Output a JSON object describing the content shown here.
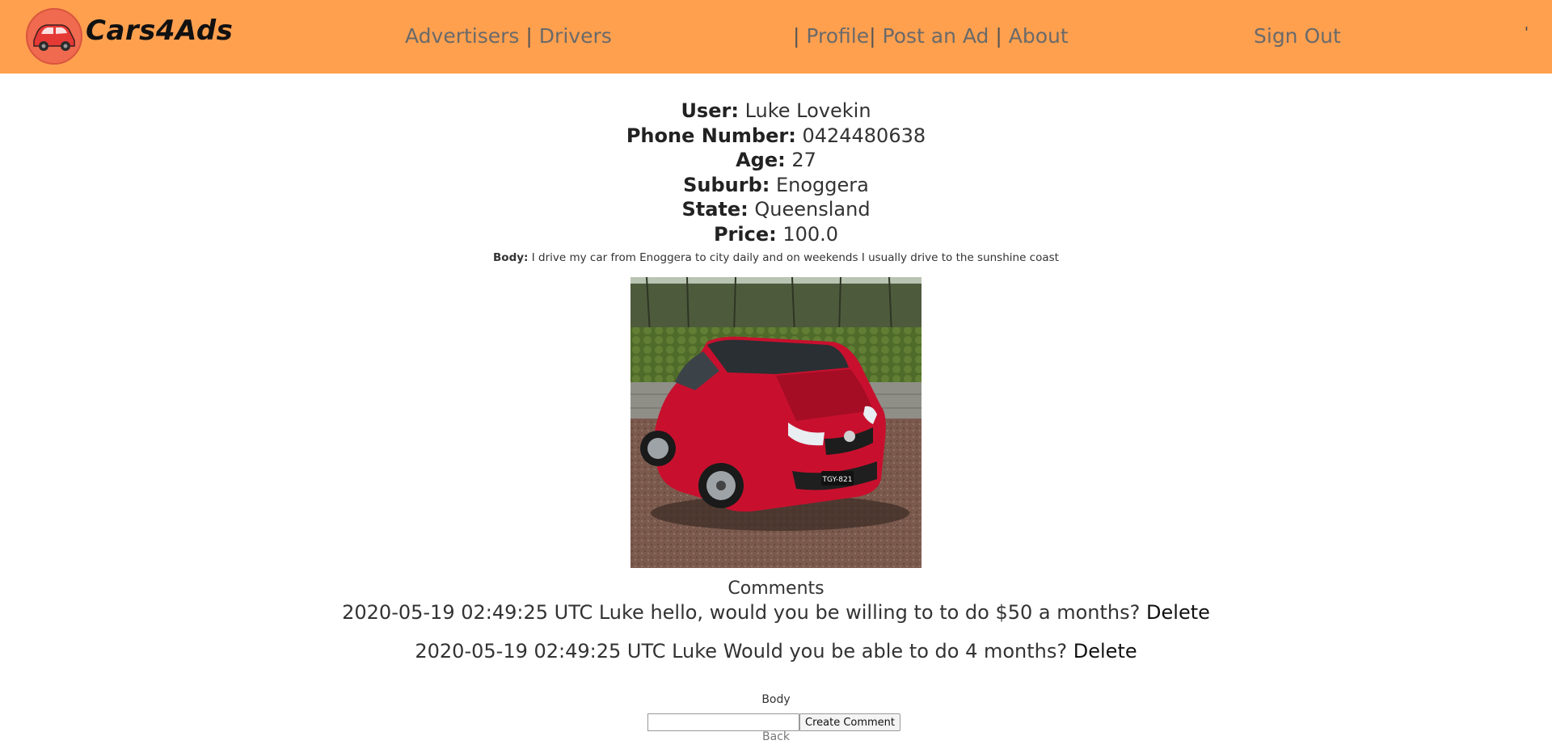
{
  "brand": {
    "name": "Cars4Ads",
    "logo_icon": "red-car-icon"
  },
  "nav": {
    "advertisers": "Advertisers",
    "drivers": "Drivers",
    "profile": "Profile",
    "post_ad": "Post an Ad",
    "about": "About",
    "sign_out": "Sign Out",
    "separator": "|",
    "tick": "'"
  },
  "details": {
    "user_label": "User:",
    "user_value": "Luke Lovekin",
    "phone_label": "Phone Number:",
    "phone_value": "0424480638",
    "age_label": "Age:",
    "age_value": "27",
    "suburb_label": "Suburb:",
    "suburb_value": "Enoggera",
    "state_label": "State:",
    "state_value": "Queensland",
    "price_label": "Price:",
    "price_value": "100.0",
    "body_label": "Body:",
    "body_value": "I drive my car from Enoggera to city daily and on weekends I usually drive to the sunshine coast"
  },
  "photo": {
    "plate": "TGY-821"
  },
  "comments": {
    "title": "Comments",
    "items": [
      {
        "text": "2020-05-19 02:49:25 UTC Luke hello, would you be willing to to do $50 a months?",
        "delete": "Delete"
      },
      {
        "text": "2020-05-19 02:49:25 UTC Luke Would you be able to do 4 months?",
        "delete": "Delete"
      }
    ]
  },
  "form": {
    "body_label": "Body",
    "body_value": "",
    "submit": "Create Comment",
    "back": "Back"
  },
  "colors": {
    "navbar": "#ffa04f",
    "car_red": "#c8102e"
  }
}
